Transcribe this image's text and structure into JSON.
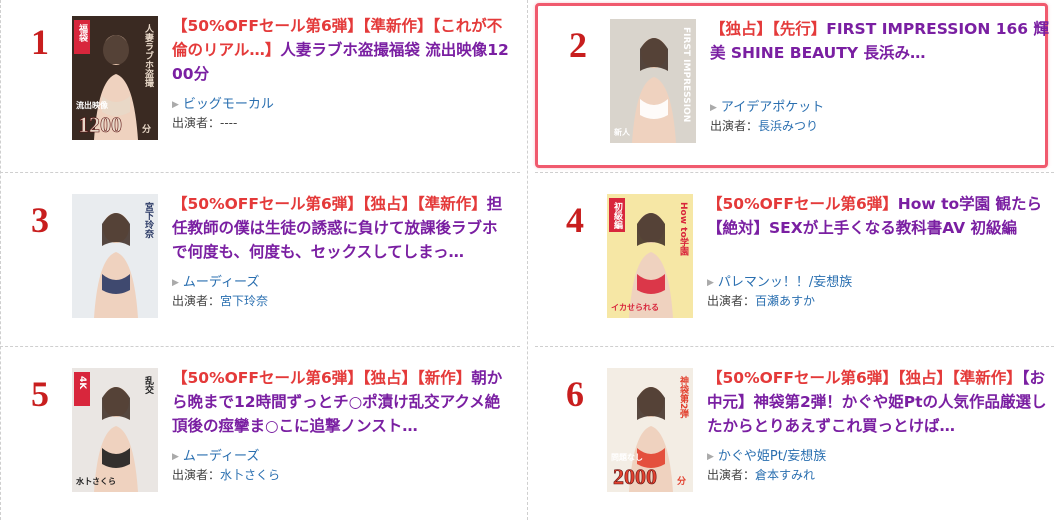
{
  "rankings": [
    {
      "rank": "1",
      "title_tags": "【50%OFFセール第6弾】【準新作】【これが不倫のリアル…】",
      "title_text": "人妻ラブホ盗撮福袋 流出映像1200分",
      "maker": "ビッグモーカル",
      "cast_label": "出演者：",
      "cast": "----",
      "cover": {
        "bg": "#3a2a22",
        "accent": "#e8d8c8",
        "text_vertical": "人妻ラブホ盗撮",
        "label": "福袋",
        "big": "1200",
        "sub": "流出映像",
        "unit": "分"
      }
    },
    {
      "rank": "2",
      "title_tags": "【独占】【先行】",
      "title_text": "FIRST IMPRESSION 166 輝美 SHINE BEAUTY 長浜み…",
      "maker": "アイデアポケット",
      "cast_label": "出演者：",
      "cast": "長浜みつり",
      "highlighted": true,
      "cover": {
        "bg": "#d9d4cc",
        "accent": "#ffffff",
        "text_vertical": "FIRST IMPRESSION",
        "label": "",
        "big": "",
        "sub": "新人",
        "unit": ""
      }
    },
    {
      "rank": "3",
      "title_tags": "【50%OFFセール第6弾】【独占】【準新作】",
      "title_text": "担任教師の僕は生徒の誘惑に負けて放課後ラブホで何度も、何度も、セックスしてしまっ…",
      "maker": "ムーディーズ",
      "cast_label": "出演者：",
      "cast": "宮下玲奈",
      "cover": {
        "bg": "#e9ecef",
        "accent": "#2b3a66",
        "text_vertical": "宮下玲奈",
        "label": "",
        "big": "",
        "sub": "",
        "unit": ""
      }
    },
    {
      "rank": "4",
      "title_tags": "【50%OFFセール第6弾】",
      "title_text": "How to学園 観たら【絶対】SEXが上手くなる教科書AV 初級編",
      "maker": "パレマンッ！！/妄想族",
      "cast_label": "出演者：",
      "cast": "百瀬あすか",
      "cover": {
        "bg": "#f6e7a5",
        "accent": "#d8263c",
        "text_vertical": "How to学園",
        "label": "初級編",
        "big": "",
        "sub": "イカせられる",
        "unit": ""
      }
    },
    {
      "rank": "5",
      "title_tags": "【50%OFFセール第6弾】【独占】【新作】",
      "title_text": "朝から晩まで12時間ずっとチ○ポ漬け乱交アクメ絶頂後の痙攣ま○こに追撃ノンスト…",
      "maker": "ムーディーズ",
      "cast_label": "出演者：",
      "cast": "水卜さくら",
      "cover": {
        "bg": "#eae6e3",
        "accent": "#1e1e1e",
        "text_vertical": "乱交",
        "label": "4K",
        "big": "",
        "sub": "水卜さくら",
        "unit": ""
      }
    },
    {
      "rank": "6",
      "title_tags": "【50%OFFセール第6弾】【独占】【準新作】",
      "title_text": "【お中元】神袋第2弾！かぐや姫Ptの人気作品厳選したからとりあえずこれ買っとけば…",
      "maker": "かぐや姫Pt/妄想族",
      "cast_label": "出演者：",
      "cast": "倉本すみれ",
      "cover": {
        "bg": "#f3ede4",
        "accent": "#e2412f",
        "text_vertical": "神袋第2弾",
        "label": "",
        "big": "2000",
        "sub": "問題なし",
        "unit": "分"
      }
    }
  ]
}
